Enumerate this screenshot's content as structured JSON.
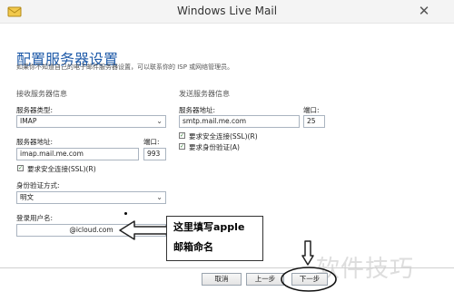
{
  "window": {
    "title": "Windows Live Mail",
    "close_glyph": "✕",
    "icon": "envelope-icon"
  },
  "header": {
    "title": "配置服务器设置",
    "subtitle": "如果你不知道自己的电子邮件服务器设置，可以联系你的 ISP 或网络管理员。"
  },
  "incoming": {
    "section_title": "接收服务器信息",
    "server_type_label": "服务器类型:",
    "server_type_value": "IMAP",
    "server_address_label": "服务器地址:",
    "server_address_value": "imap.mail.me.com",
    "port_label": "端口:",
    "port_value": "993",
    "ssl_label": "要求安全连接(SSL)(R)",
    "ssl_checked": true,
    "auth_label": "身份验证方式:",
    "auth_value": "明文",
    "login_label": "登录用户名:",
    "login_value": "@icloud.com"
  },
  "outgoing": {
    "section_title": "发送服务器信息",
    "server_address_label": "服务器地址:",
    "server_address_value": "smtp.mail.me.com",
    "port_label": "端口:",
    "port_value": "25",
    "ssl_label": "要求安全连接(SSL)(R)",
    "ssl_checked": true,
    "auth_label": "要求身份验证(A)",
    "auth_checked": true
  },
  "buttons": {
    "cancel": "取消",
    "back": "上一步",
    "next": "下一步"
  },
  "annotation": {
    "line1": "这里填写apple",
    "line2": "邮箱命名"
  },
  "watermark": "软件技巧",
  "colors": {
    "title_blue": "#1e5aa8",
    "annotation_ink": "#000000"
  }
}
